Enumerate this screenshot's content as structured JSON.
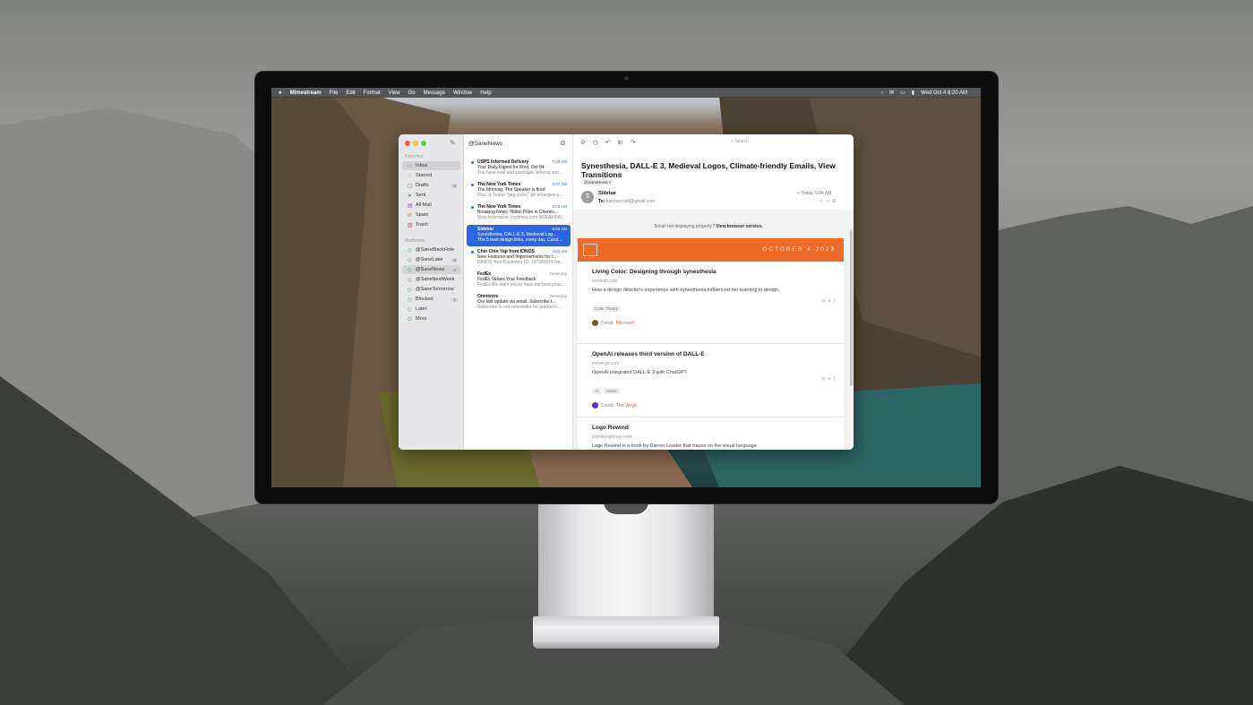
{
  "menubar": {
    "app": "Mimestream",
    "items": [
      "File",
      "Edit",
      "Format",
      "View",
      "Go",
      "Message",
      "Window",
      "Help"
    ],
    "clock": "Wed Oct 4  8:20 AM"
  },
  "sidebar": {
    "favorites_label": "Favorites",
    "favorites": [
      {
        "label": "Inbox",
        "icon": "inbox-icon",
        "count": ""
      },
      {
        "label": "Starred",
        "icon": "star-icon",
        "count": ""
      },
      {
        "label": "Drafts",
        "icon": "draft-icon",
        "count": "6"
      },
      {
        "label": "Sent",
        "icon": "send-icon",
        "count": ""
      },
      {
        "label": "All Mail",
        "icon": "archive-icon",
        "count": ""
      },
      {
        "label": "Spam",
        "icon": "spam-icon",
        "count": ""
      },
      {
        "label": "Trash",
        "icon": "trash-icon",
        "count": ""
      }
    ],
    "mailboxes_label": "Mailboxes",
    "mailboxes": [
      {
        "label": "@SaneBlackHole",
        "count": ""
      },
      {
        "label": "@SaneLater",
        "count": "5"
      },
      {
        "label": "@SaneNews",
        "count": "4"
      },
      {
        "label": "@SaneNextWeek",
        "count": ""
      },
      {
        "label": "@SaneTomorrow",
        "count": ""
      },
      {
        "label": "Blocked",
        "count": "1"
      },
      {
        "label": "Later",
        "count": ""
      },
      {
        "label": "More",
        "count": ""
      }
    ]
  },
  "list": {
    "title": "@SaneNews",
    "messages": [
      {
        "from": "USPS Informed Delivery",
        "time": "7:26 AM",
        "subject": "Your Daily Digest for Wed, Oct 04",
        "preview": "You have mail and packages arriving soo..."
      },
      {
        "from": "The New York Times",
        "time": "5:47 AM",
        "subject": "The Morning: The Speaker is fired",
        "preview": "Plus, a Trump \"gag order,\" an emergency..."
      },
      {
        "from": "The New York Times",
        "time": "5:04 AM",
        "subject": "Breaking News: Nobel Prize in Chemis...",
        "preview": "View in browser | nytimes.com BREAKING..."
      },
      {
        "from": "Sidebar",
        "time": "5:04 AM",
        "subject": "Synesthesia, DALL-E 3, Medieval Log...",
        "preview": "The 5 best design links, every day. Curat..."
      },
      {
        "from": "Chin Chin Yap from IONOS",
        "time": "2:02 AM",
        "subject": "New Features and Improvements for t...",
        "preview": "IONOS Your Customer ID: 197380674 Ne..."
      },
      {
        "from": "FedEx",
        "time": "Yesterday",
        "subject": "FedEx Values Your Feedback",
        "preview": "FedEx We want you to have the best poss..."
      },
      {
        "from": "Omnivore",
        "time": "Yesterday",
        "subject": "Our last update via email. Subscribe t...",
        "preview": "Subscribe to our newsletter for product c..."
      }
    ]
  },
  "reader": {
    "search_placeholder": "Search",
    "title": "Synesthesia, DALL-E 3, Medieval Logos, Climate-friendly Emails, View Transitions",
    "tag": "@SaneNews ×",
    "avatar_letter": "S",
    "sender": "Sidebar",
    "to_label": "To:",
    "to_address": "bincherrnatt@gmail.com",
    "date": "Today, 5:04 AM",
    "notice_text": "Email not displaying properly?",
    "notice_link": "View browser version.",
    "banner_date": "OCTOBER 4 2023",
    "credit_label": "Credit:",
    "cards": [
      {
        "title": "Living Color: Designing through synesthesia",
        "source": "medium.com",
        "desc": "How a design director's experience with synesthesia influenced her learning in design.",
        "tags": [
          "Color Theory"
        ],
        "credit": "Microsoft"
      },
      {
        "title": "OpenAI releases third version of DALL-E",
        "source": "theverge.com",
        "desc": "OpenAI integrated DALL-E 3 with ChatGPT.",
        "tags": [
          "AI",
          "News"
        ],
        "credit": "The Verge"
      },
      {
        "title": "Logo Rewind",
        "source": "logodesignlove.com",
        "desc": "Logo Rewind is a book by Darren Leader that traces on the visual language"
      }
    ]
  },
  "colors": {
    "accent": "#2d65e0",
    "banner": "#ee6a26"
  }
}
